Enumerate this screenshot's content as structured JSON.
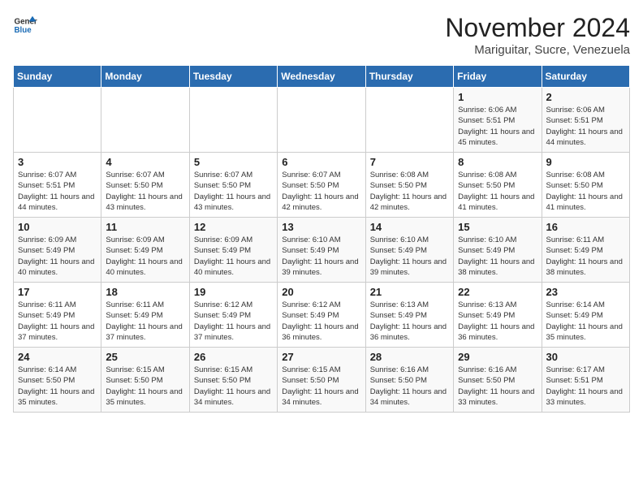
{
  "header": {
    "logo_general": "General",
    "logo_blue": "Blue",
    "month_title": "November 2024",
    "subtitle": "Mariguitar, Sucre, Venezuela"
  },
  "weekdays": [
    "Sunday",
    "Monday",
    "Tuesday",
    "Wednesday",
    "Thursday",
    "Friday",
    "Saturday"
  ],
  "weeks": [
    [
      {
        "day": "",
        "info": ""
      },
      {
        "day": "",
        "info": ""
      },
      {
        "day": "",
        "info": ""
      },
      {
        "day": "",
        "info": ""
      },
      {
        "day": "",
        "info": ""
      },
      {
        "day": "1",
        "info": "Sunrise: 6:06 AM\nSunset: 5:51 PM\nDaylight: 11 hours and 45 minutes."
      },
      {
        "day": "2",
        "info": "Sunrise: 6:06 AM\nSunset: 5:51 PM\nDaylight: 11 hours and 44 minutes."
      }
    ],
    [
      {
        "day": "3",
        "info": "Sunrise: 6:07 AM\nSunset: 5:51 PM\nDaylight: 11 hours and 44 minutes."
      },
      {
        "day": "4",
        "info": "Sunrise: 6:07 AM\nSunset: 5:50 PM\nDaylight: 11 hours and 43 minutes."
      },
      {
        "day": "5",
        "info": "Sunrise: 6:07 AM\nSunset: 5:50 PM\nDaylight: 11 hours and 43 minutes."
      },
      {
        "day": "6",
        "info": "Sunrise: 6:07 AM\nSunset: 5:50 PM\nDaylight: 11 hours and 42 minutes."
      },
      {
        "day": "7",
        "info": "Sunrise: 6:08 AM\nSunset: 5:50 PM\nDaylight: 11 hours and 42 minutes."
      },
      {
        "day": "8",
        "info": "Sunrise: 6:08 AM\nSunset: 5:50 PM\nDaylight: 11 hours and 41 minutes."
      },
      {
        "day": "9",
        "info": "Sunrise: 6:08 AM\nSunset: 5:50 PM\nDaylight: 11 hours and 41 minutes."
      }
    ],
    [
      {
        "day": "10",
        "info": "Sunrise: 6:09 AM\nSunset: 5:49 PM\nDaylight: 11 hours and 40 minutes."
      },
      {
        "day": "11",
        "info": "Sunrise: 6:09 AM\nSunset: 5:49 PM\nDaylight: 11 hours and 40 minutes."
      },
      {
        "day": "12",
        "info": "Sunrise: 6:09 AM\nSunset: 5:49 PM\nDaylight: 11 hours and 40 minutes."
      },
      {
        "day": "13",
        "info": "Sunrise: 6:10 AM\nSunset: 5:49 PM\nDaylight: 11 hours and 39 minutes."
      },
      {
        "day": "14",
        "info": "Sunrise: 6:10 AM\nSunset: 5:49 PM\nDaylight: 11 hours and 39 minutes."
      },
      {
        "day": "15",
        "info": "Sunrise: 6:10 AM\nSunset: 5:49 PM\nDaylight: 11 hours and 38 minutes."
      },
      {
        "day": "16",
        "info": "Sunrise: 6:11 AM\nSunset: 5:49 PM\nDaylight: 11 hours and 38 minutes."
      }
    ],
    [
      {
        "day": "17",
        "info": "Sunrise: 6:11 AM\nSunset: 5:49 PM\nDaylight: 11 hours and 37 minutes."
      },
      {
        "day": "18",
        "info": "Sunrise: 6:11 AM\nSunset: 5:49 PM\nDaylight: 11 hours and 37 minutes."
      },
      {
        "day": "19",
        "info": "Sunrise: 6:12 AM\nSunset: 5:49 PM\nDaylight: 11 hours and 37 minutes."
      },
      {
        "day": "20",
        "info": "Sunrise: 6:12 AM\nSunset: 5:49 PM\nDaylight: 11 hours and 36 minutes."
      },
      {
        "day": "21",
        "info": "Sunrise: 6:13 AM\nSunset: 5:49 PM\nDaylight: 11 hours and 36 minutes."
      },
      {
        "day": "22",
        "info": "Sunrise: 6:13 AM\nSunset: 5:49 PM\nDaylight: 11 hours and 36 minutes."
      },
      {
        "day": "23",
        "info": "Sunrise: 6:14 AM\nSunset: 5:49 PM\nDaylight: 11 hours and 35 minutes."
      }
    ],
    [
      {
        "day": "24",
        "info": "Sunrise: 6:14 AM\nSunset: 5:50 PM\nDaylight: 11 hours and 35 minutes."
      },
      {
        "day": "25",
        "info": "Sunrise: 6:15 AM\nSunset: 5:50 PM\nDaylight: 11 hours and 35 minutes."
      },
      {
        "day": "26",
        "info": "Sunrise: 6:15 AM\nSunset: 5:50 PM\nDaylight: 11 hours and 34 minutes."
      },
      {
        "day": "27",
        "info": "Sunrise: 6:15 AM\nSunset: 5:50 PM\nDaylight: 11 hours and 34 minutes."
      },
      {
        "day": "28",
        "info": "Sunrise: 6:16 AM\nSunset: 5:50 PM\nDaylight: 11 hours and 34 minutes."
      },
      {
        "day": "29",
        "info": "Sunrise: 6:16 AM\nSunset: 5:50 PM\nDaylight: 11 hours and 33 minutes."
      },
      {
        "day": "30",
        "info": "Sunrise: 6:17 AM\nSunset: 5:51 PM\nDaylight: 11 hours and 33 minutes."
      }
    ]
  ]
}
